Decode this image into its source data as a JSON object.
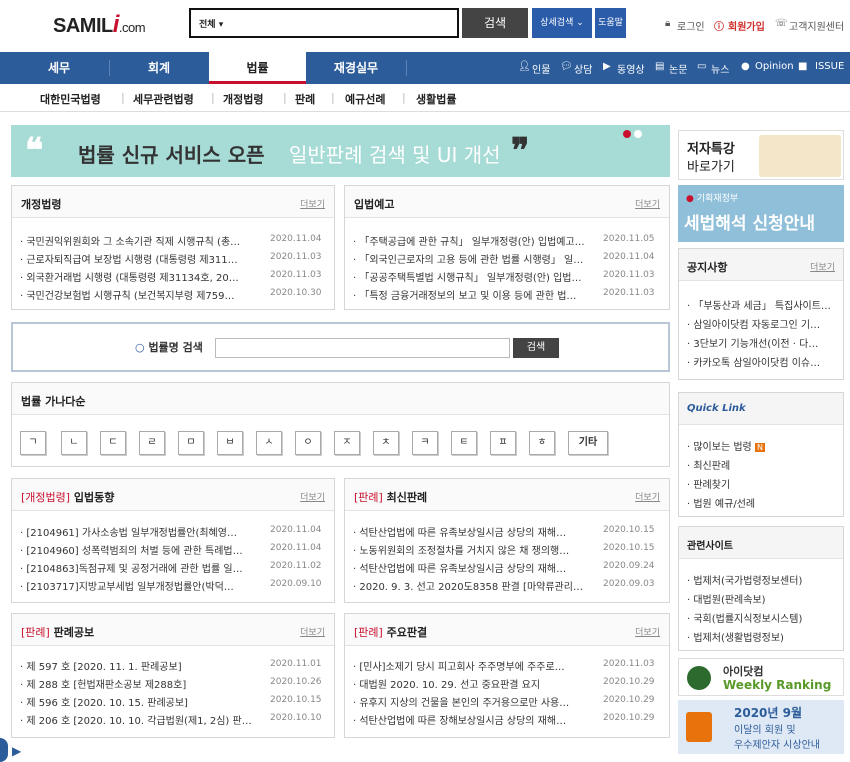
{
  "header": {
    "logo": {
      "a": "SAMIL",
      "b": "i",
      "c": ".com"
    },
    "search": {
      "scope": "전체 ▾",
      "button": "검색"
    },
    "detail_search": "상세검색 ⌄",
    "help": "도움말",
    "util": {
      "login": "로그인",
      "join": "회원가입",
      "support": "고객지원센터"
    }
  },
  "nav": {
    "items": [
      "세무",
      "회계",
      "법률",
      "재경실무"
    ],
    "right": [
      "인물",
      "상담",
      "동영상",
      "논문",
      "뉴스",
      "Opinion",
      "ISSUE"
    ]
  },
  "subnav": [
    "대한민국법령",
    "세무관련법령",
    "개정법령",
    "판례",
    "예규선례",
    "생활법률"
  ],
  "banner": {
    "open_quote": "❝",
    "title": "법률 신규 서비스 오픈",
    "subtitle": "일반판례 검색 및 UI 개선",
    "close_quote": "❞"
  },
  "more": "더보기",
  "revised": {
    "title": "개정법령",
    "rows": [
      {
        "t": "· 국민권익위원회와 그 소속기관 직제 시행규칙 (총…",
        "d": "2020.11.04"
      },
      {
        "t": "· 근로자퇴직급여 보장법 시행령 (대통령령 제311…",
        "d": "2020.11.03"
      },
      {
        "t": "· 외국환거래법 시행령 (대통령령 제31134호, 20…",
        "d": "2020.11.03"
      },
      {
        "t": "· 국민건강보험법 시행규칙 (보건복지부령 제759…",
        "d": "2020.10.30"
      }
    ]
  },
  "notice": {
    "title": "입법예고",
    "rows": [
      {
        "t": "· 「주택공급에 관한 규칙」 일부개정령(안) 입법예고…",
        "d": "2020.11.05"
      },
      {
        "t": "· 「외국인근로자의 고용 등에 관한 법률 시행령」 일…",
        "d": "2020.11.04"
      },
      {
        "t": "· 「공공주택특별법 시행규칙」 일부개정령(안) 입법…",
        "d": "2020.11.03"
      },
      {
        "t": "· 「특정 금융거래정보의 보고 및 이용 등에 관한 법…",
        "d": "2020.11.03"
      }
    ]
  },
  "law_search": {
    "label": "법률명 검색",
    "button": "검색"
  },
  "alpha": {
    "title": "법률 가나다순",
    "keys": [
      "ㄱ",
      "ㄴ",
      "ㄷ",
      "ㄹ",
      "ㅁ",
      "ㅂ",
      "ㅅ",
      "ㅇ",
      "ㅈ",
      "ㅊ",
      "ㅋ",
      "ㅌ",
      "ㅍ",
      "ㅎ",
      "기타"
    ]
  },
  "legis": {
    "tag": "[개정법령]",
    "title": "입법동향",
    "rows": [
      {
        "t": "· [2104961] 가사소송법 일부개정법률안(최혜영…",
        "d": "2020.11.04"
      },
      {
        "t": "· [2104960] 성폭력범죄의 처벌 등에 관한 특례법…",
        "d": "2020.11.04"
      },
      {
        "t": "· [2104863]독점규제 및 공정거래에 관한 법률 일…",
        "d": "2020.11.02"
      },
      {
        "t": "· [2103717]지방교부세법 일부개정법률안(박덕…",
        "d": "2020.09.10"
      }
    ]
  },
  "latest": {
    "tag": "[판례]",
    "title": "최신판례",
    "rows": [
      {
        "t": "· 석탄산업법에 따른 유족보상일시금 상당의 재해…",
        "d": "2020.10.15"
      },
      {
        "t": "· 노동위원회의 조정절차를 거치지 않은 채 쟁의행…",
        "d": "2020.10.15"
      },
      {
        "t": "· 석탄산업법에 따른 유족보상일시금 상당의 재해…",
        "d": "2020.09.24"
      },
      {
        "t": "· 2020. 9. 3. 선고 2020도8358 판결 [마약류관리…",
        "d": "2020.09.03"
      }
    ]
  },
  "bulletin": {
    "tag": "[판례]",
    "title": "판례공보",
    "rows": [
      {
        "t": "· 제 597 호 [2020. 11. 1. 판례공보]",
        "d": "2020.11.01"
      },
      {
        "t": "· 제 288 호 [헌법재판소공보 제288호]",
        "d": "2020.10.26"
      },
      {
        "t": "· 제 596 호 [2020. 10. 15. 판례공보]",
        "d": "2020.10.15"
      },
      {
        "t": "· 제 206 호 [2020. 10. 10. 각급법원(제1, 2심) 판…",
        "d": "2020.10.10"
      }
    ]
  },
  "major": {
    "tag": "[판례]",
    "title": "주요판결",
    "rows": [
      {
        "t": "· [민사]소제기 당시 피고회사 주주명부에 주주로…",
        "d": "2020.11.03"
      },
      {
        "t": "· 대법원 2020. 10. 29. 선고 중요판결 요지",
        "d": "2020.10.29"
      },
      {
        "t": "· 유후지 지상의 건물을 본인의 주거용으로만 사용…",
        "d": "2020.10.29"
      },
      {
        "t": "· 석탄산업법에 따른 장해보상일시금 상당의 재해…",
        "d": "2020.10.29"
      }
    ]
  },
  "side": {
    "special": {
      "line1": "저자특강",
      "line2": "바로가기"
    },
    "moef": {
      "org": "기획재정부",
      "title": "세법해석 신청안내"
    },
    "announce": {
      "title": "공지사항",
      "rows": [
        "· 「부동산과 세금」 특집사이트…",
        "· 삼일아이닷컴 자동로그인 기…",
        "· 3단보기 기능개선(이전 · 다…",
        "· 카카오톡 삼일아이닷컴 이슈…"
      ]
    },
    "quick": {
      "title": "Quick Link",
      "rows": [
        "· 많이보는 법령",
        "· 최신판례",
        "· 판례찾기",
        "· 법원 예규/선례"
      ],
      "badge": "N"
    },
    "related": {
      "title": "관련사이트",
      "rows": [
        "· 법제처(국가법령정보센터)",
        "· 대법원(판례속보)",
        "· 국회(법률지식정보시스템)",
        "· 법제처(생활법령정보)"
      ]
    },
    "weekly": {
      "line1": "아이닷컴",
      "line2": "Weekly Ranking"
    },
    "monthly": {
      "line1": "2020년 9월",
      "line2": "이달의 회원 및",
      "line3": "우수제안자 시상안내"
    }
  },
  "colors": {
    "nav": "#2c5c9a",
    "accent": "#c8102e",
    "banner": "#a6dbd6"
  }
}
